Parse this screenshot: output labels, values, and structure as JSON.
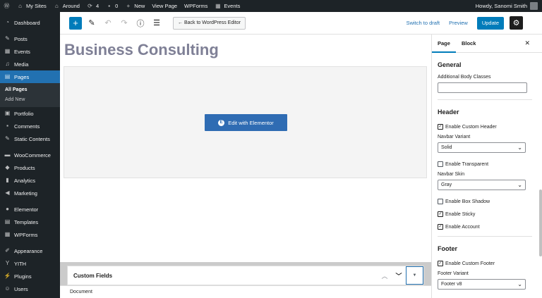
{
  "adminbar": {
    "sites": "My Sites",
    "site": "Around",
    "updates": "4",
    "comments": "0",
    "new": "New",
    "view_page": "View Page",
    "wpforms": "WPForms",
    "events": "Events",
    "greeting": "Howdy, Sanomi Smith"
  },
  "sidebar": {
    "items_top": [
      {
        "label": "Dashboard",
        "icon": "dashboard-icon"
      },
      {
        "label": "Posts",
        "icon": "pin-icon"
      },
      {
        "label": "Events",
        "icon": "calendar-icon"
      },
      {
        "label": "Media",
        "icon": "media-icon"
      },
      {
        "label": "Pages",
        "icon": "pages-icon"
      }
    ],
    "sub": [
      "All Pages",
      "Add New"
    ],
    "items_mid": [
      {
        "label": "Portfolio",
        "icon": "portfolio-icon"
      },
      {
        "label": "Comments",
        "icon": "comment-icon"
      },
      {
        "label": "Static Contents",
        "icon": "pin-icon"
      }
    ],
    "items_woo": [
      {
        "label": "WooCommerce",
        "icon": "woo-icon"
      },
      {
        "label": "Products",
        "icon": "products-icon"
      },
      {
        "label": "Analytics",
        "icon": "analytics-icon"
      },
      {
        "label": "Marketing",
        "icon": "megaphone-icon"
      }
    ],
    "items_el": [
      {
        "label": "Elementor",
        "icon": "elementor-icon"
      },
      {
        "label": "Templates",
        "icon": "templates-icon"
      },
      {
        "label": "WPForms",
        "icon": "forms-icon"
      }
    ],
    "items_bottom": [
      {
        "label": "Appearance",
        "icon": "brush-icon"
      },
      {
        "label": "YITH",
        "icon": "yith-icon"
      },
      {
        "label": "Plugins",
        "icon": "plugin-icon"
      },
      {
        "label": "Users",
        "icon": "user-icon"
      }
    ]
  },
  "toolbar": {
    "back_label": "← Back to WordPress Editor",
    "switch_draft": "Switch to draft",
    "preview": "Preview",
    "update": "Update"
  },
  "canvas": {
    "title": "Business Consulting",
    "elementor_button": "Edit with Elementor",
    "elementor_logo": "E"
  },
  "meta": {
    "custom_fields": "Custom Fields",
    "footer_label": "Document"
  },
  "panel": {
    "tab_page": "Page",
    "tab_block": "Block",
    "general": {
      "title": "General",
      "body_classes_label": "Additional Body Classes"
    },
    "header": {
      "title": "Header",
      "enable_custom_header": "Enable Custom Header",
      "navbar_variant_label": "Navbar Variant",
      "navbar_variant_value": "Solid",
      "enable_transparent": "Enable Transparent",
      "navbar_skin_label": "Navbar Skin",
      "navbar_skin_value": "Gray",
      "enable_box_shadow": "Enable Box Shadow",
      "enable_sticky": "Enable Sticky",
      "enable_account": "Enable Account"
    },
    "footer": {
      "title": "Footer",
      "enable_custom_footer": "Enable Custom Footer",
      "footer_variant_label": "Footer Variant",
      "footer_variant_value": "Footer v8"
    }
  }
}
